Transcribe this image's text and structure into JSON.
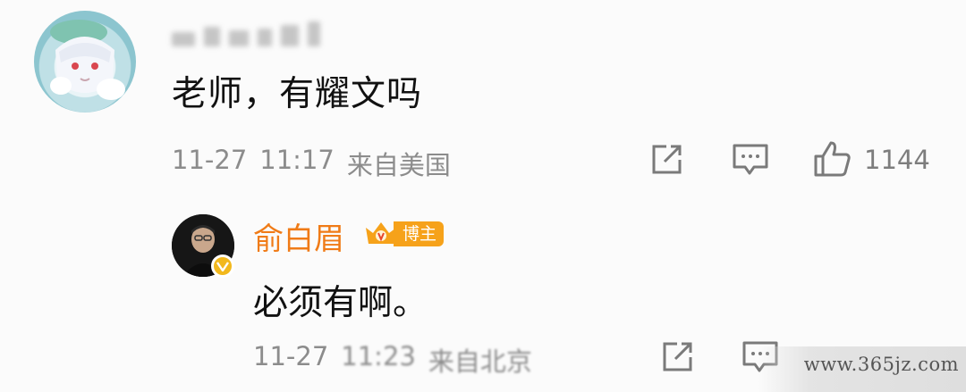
{
  "comment": {
    "username": "",
    "text": "老师，有耀文吗",
    "date": "11-27",
    "time": "11:17",
    "location": "来自美国",
    "likes": "1144",
    "icons": [
      "share-icon",
      "comment-icon",
      "like-icon"
    ]
  },
  "reply": {
    "username": "俞白眉",
    "badge": "博主",
    "text": "必须有啊。",
    "date": "11-27",
    "time": "11:23",
    "location": "来自北京",
    "icons": [
      "share-icon",
      "comment-icon"
    ]
  },
  "watermark": "www.365jz.com",
  "colors": {
    "name_orange": "#f07b17",
    "badge_orange": "#f6a21a",
    "meta_gray": "#8c8c8c",
    "verify_gold": "#f2b81c"
  }
}
